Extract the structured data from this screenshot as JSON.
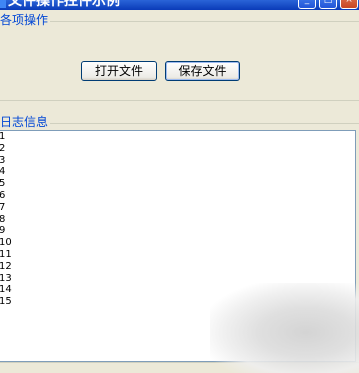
{
  "window": {
    "title": "文件操作控件示例",
    "min_label": "_",
    "max_label": "□",
    "close_label": "×"
  },
  "groups": {
    "operations_label": "各项操作",
    "log_label": "日志信息"
  },
  "buttons": {
    "open_label": "打开文件",
    "save_label": "保存文件"
  },
  "log": {
    "lines": [
      "1",
      "2",
      "3",
      "4",
      "5",
      "6",
      "7",
      "8",
      "9",
      "10",
      "11",
      "12",
      "13",
      "14",
      "15"
    ]
  }
}
